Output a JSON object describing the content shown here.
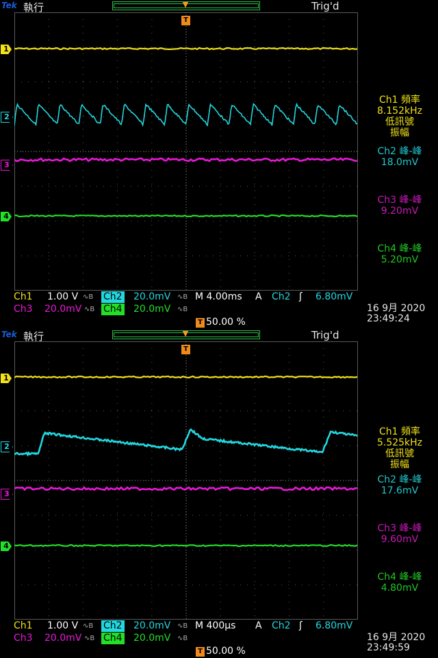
{
  "colors": {
    "ch1": "#f2e21a",
    "ch2": "#22d8e0",
    "ch3": "#ea18d8",
    "ch4": "#22e028",
    "trigger": "#f08a1a",
    "grid": "#5a5a5a"
  },
  "icons": {
    "trigger_marker": "T-badge",
    "edge": "rising-edge-icon",
    "bw_limit": "bandwidth-limit-icon"
  },
  "screens": [
    {
      "brand": "Tek",
      "run_state": "執行",
      "trig_state": "Trig'd",
      "trig_marker": "T",
      "channel_markers": [
        "1",
        "2",
        "3",
        "4"
      ],
      "measurements": [
        {
          "title": "Ch1 頻率",
          "value": "8.152kHz",
          "note1": "低訊號",
          "note2": "振幅"
        },
        {
          "title": "Ch2 峰-峰",
          "value": "18.0mV"
        },
        {
          "title": "Ch3 峰-峰",
          "value": "9.20mV"
        },
        {
          "title": "Ch4 峰-峰",
          "value": "5.20mV"
        }
      ],
      "status": {
        "ch1_label": "Ch1",
        "ch1_scale": "1.00 V",
        "ch2_label": "Ch2",
        "ch2_scale": "20.0mV",
        "ch3_label": "Ch3",
        "ch3_scale": "20.0mV",
        "ch4_label": "Ch4",
        "ch4_scale": "20.0mV",
        "timebase": "M 4.00ms",
        "trig_mode": "A",
        "trig_source": "Ch2",
        "trig_level": "6.80mV",
        "trig_position": "50.00 %",
        "date": "16 9月  2020",
        "time": "23:49:24"
      },
      "ch2_wave": {
        "type": "sawtooth",
        "cycles": 16
      }
    },
    {
      "brand": "Tek",
      "run_state": "執行",
      "trig_state": "Trig'd",
      "trig_marker": "T",
      "channel_markers": [
        "1",
        "2",
        "3",
        "4"
      ],
      "measurements": [
        {
          "title": "Ch1 頻率",
          "value": "5.525kHz",
          "note1": "低訊號",
          "note2": "振幅"
        },
        {
          "title": "Ch2 峰-峰",
          "value": "17.6mV"
        },
        {
          "title": "Ch3 峰-峰",
          "value": "9.60mV"
        },
        {
          "title": "Ch4 峰-峰",
          "value": "4.80mV"
        }
      ],
      "status": {
        "ch1_label": "Ch1",
        "ch1_scale": "1.00 V",
        "ch2_label": "Ch2",
        "ch2_scale": "20.0mV",
        "ch3_label": "Ch3",
        "ch3_scale": "20.0mV",
        "ch4_label": "Ch4",
        "ch4_scale": "20.0mV",
        "timebase": "M 400µs",
        "trig_mode": "A",
        "trig_source": "Ch2",
        "trig_level": "6.80mV",
        "trig_position": "50.00 %",
        "date": "16 9月  2020",
        "time": "23:49:59"
      },
      "ch2_wave": {
        "type": "ramp",
        "cycles": 1
      }
    }
  ]
}
